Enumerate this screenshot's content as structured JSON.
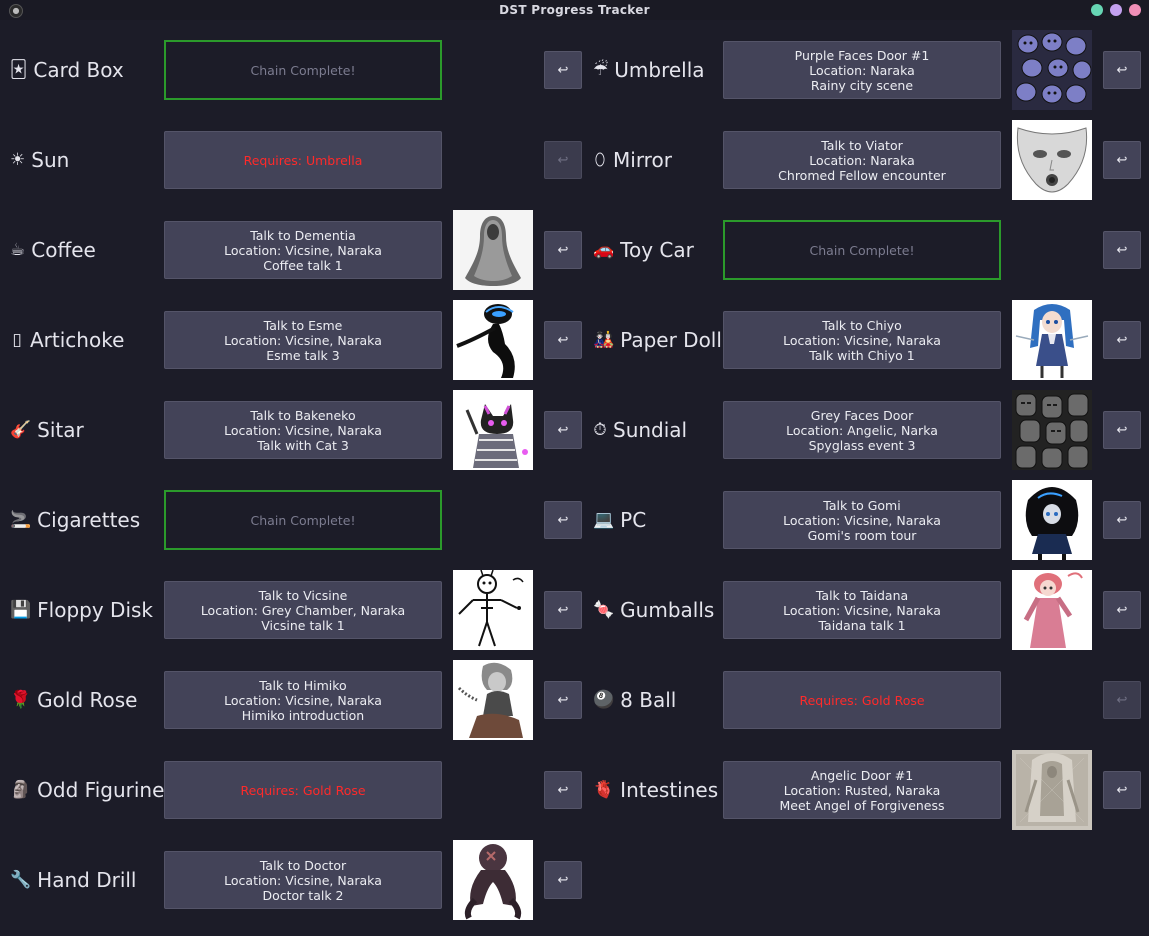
{
  "window": {
    "title": "DST Progress Tracker",
    "buttons": [
      {
        "name": "window-button-teal",
        "color": "#67d6b4"
      },
      {
        "name": "window-button-lilac",
        "color": "#c3a0ee"
      },
      {
        "name": "window-button-pink",
        "color": "#f18fb7"
      }
    ]
  },
  "undo_symbol": "↩",
  "left_items": [
    {
      "label": "Card Box",
      "icon": "🃏",
      "icon_name": "card-box-icon",
      "status": "complete",
      "lines": [
        "Chain Complete!"
      ],
      "thumb": null,
      "undo_enabled": true
    },
    {
      "label": "Sun",
      "icon": "☀",
      "icon_name": "sun-icon",
      "status": "locked",
      "lines": [
        "Requires: Umbrella"
      ],
      "thumb": null,
      "undo_enabled": false
    },
    {
      "label": "Coffee",
      "icon": "☕",
      "icon_name": "coffee-icon",
      "status": "active",
      "lines": [
        "Talk to Dementia",
        "Location: Vicsine, Naraka",
        "Coffee talk 1"
      ],
      "thumb": "dementia",
      "undo_enabled": true
    },
    {
      "label": "Artichoke",
      "icon": "▯",
      "icon_name": "artichoke-icon",
      "status": "active",
      "lines": [
        "Talk to Esme",
        "Location: Vicsine, Naraka",
        "Esme talk 3"
      ],
      "thumb": "esme",
      "undo_enabled": true
    },
    {
      "label": "Sitar",
      "icon": "🎸",
      "icon_name": "sitar-icon",
      "status": "active",
      "lines": [
        "Talk to Bakeneko",
        "Location: Vicsine, Naraka",
        "Talk with Cat 3"
      ],
      "thumb": "bakeneko",
      "undo_enabled": true
    },
    {
      "label": "Cigarettes",
      "icon": "🚬",
      "icon_name": "cigarettes-icon",
      "status": "complete",
      "lines": [
        "Chain Complete!"
      ],
      "thumb": null,
      "undo_enabled": true
    },
    {
      "label": "Floppy Disk",
      "icon": "💾",
      "icon_name": "floppy-disk-icon",
      "status": "active",
      "lines": [
        "Talk to Vicsine",
        "Location: Grey Chamber, Naraka",
        "Vicsine talk 1"
      ],
      "thumb": "vicsine",
      "undo_enabled": true
    },
    {
      "label": "Gold Rose",
      "icon": "🌹",
      "icon_name": "gold-rose-icon",
      "status": "active",
      "lines": [
        "Talk to Himiko",
        "Location: Vicsine, Naraka",
        "Himiko introduction"
      ],
      "thumb": "himiko",
      "undo_enabled": true
    },
    {
      "label": "Odd Figurine",
      "icon": "🗿",
      "icon_name": "odd-figurine-icon",
      "status": "locked",
      "lines": [
        "Requires: Gold Rose"
      ],
      "thumb": null,
      "undo_enabled": true
    },
    {
      "label": "Hand Drill",
      "icon": "🔧",
      "icon_name": "hand-drill-icon",
      "status": "active",
      "lines": [
        "Talk to Doctor",
        "Location: Vicsine, Naraka",
        "Doctor talk 2"
      ],
      "thumb": "doctor",
      "undo_enabled": true
    }
  ],
  "right_items": [
    {
      "label": "Umbrella",
      "icon": "☔",
      "icon_name": "umbrella-icon",
      "status": "active",
      "lines": [
        "Purple Faces Door #1",
        "Location: Naraka",
        "Rainy city scene"
      ],
      "thumb": "purple-faces",
      "undo_enabled": true
    },
    {
      "label": "Mirror",
      "icon": "⬯",
      "icon_name": "mirror-icon",
      "status": "active",
      "lines": [
        "Talk to Viator",
        "Location: Naraka",
        "Chromed Fellow encounter"
      ],
      "thumb": "viator",
      "undo_enabled": true
    },
    {
      "label": "Toy Car",
      "icon": "🚗",
      "icon_name": "toy-car-icon",
      "status": "complete",
      "lines": [
        "Chain Complete!"
      ],
      "thumb": null,
      "undo_enabled": true
    },
    {
      "label": "Paper Doll",
      "icon": "🎎",
      "icon_name": "paper-doll-icon",
      "status": "active",
      "lines": [
        "Talk to Chiyo",
        "Location: Vicsine, Naraka",
        "Talk with Chiyo 1"
      ],
      "thumb": "chiyo",
      "undo_enabled": true
    },
    {
      "label": "Sundial",
      "icon": "⏱",
      "icon_name": "sundial-icon",
      "status": "active",
      "lines": [
        "Grey Faces Door",
        "Location: Angelic, Narka",
        "Spyglass event 3"
      ],
      "thumb": "grey-faces",
      "undo_enabled": true
    },
    {
      "label": "PC",
      "icon": "💻",
      "icon_name": "pc-icon",
      "status": "active",
      "lines": [
        "Talk to Gomi",
        "Location: Vicsine, Naraka",
        "Gomi's room tour"
      ],
      "thumb": "gomi",
      "undo_enabled": true
    },
    {
      "label": "Gumballs",
      "icon": "🍬",
      "icon_name": "gumballs-icon",
      "status": "active",
      "lines": [
        "Talk to Taidana",
        "Location: Vicsine, Naraka",
        "Taidana talk 1"
      ],
      "thumb": "taidana",
      "undo_enabled": true
    },
    {
      "label": "8 Ball",
      "icon": "🎱",
      "icon_name": "eight-ball-icon",
      "status": "locked",
      "lines": [
        "Requires: Gold Rose"
      ],
      "thumb": null,
      "undo_enabled": false
    },
    {
      "label": "Intestines",
      "icon": "🫀",
      "icon_name": "intestines-icon",
      "status": "active",
      "lines": [
        "Angelic Door #1",
        "Location: Rusted, Naraka",
        "Meet Angel of Forgiveness"
      ],
      "thumb": "angel",
      "undo_enabled": true
    }
  ]
}
